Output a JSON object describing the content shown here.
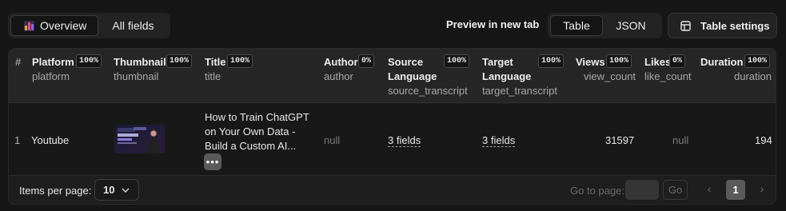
{
  "toolbar": {
    "tabs": [
      "Overview",
      "All fields"
    ],
    "preview_link": "Preview in new tab",
    "formats": [
      "Table",
      "JSON"
    ],
    "settings_label": "Table settings"
  },
  "table": {
    "columns": [
      {
        "label": "#",
        "key": "",
        "pct": ""
      },
      {
        "label": "Platform",
        "key": "platform",
        "pct": "100%"
      },
      {
        "label": "Thumbnail",
        "key": "thumbnail",
        "pct": "100%"
      },
      {
        "label": "Title",
        "key": "title",
        "pct": "100%"
      },
      {
        "label": "Author",
        "key": "author",
        "pct": "0%"
      },
      {
        "label": "Source Language",
        "label_line1": "Source",
        "label_line2": "Language",
        "key": "source_transcript",
        "pct": "100%"
      },
      {
        "label": "Target Language",
        "label_line1": "Target",
        "label_line2": "Language",
        "key": "target_transcript",
        "pct": "100%"
      },
      {
        "label": "Views",
        "key": "view_count",
        "pct": "100%"
      },
      {
        "label": "Likes",
        "key": "like_count",
        "pct": "0%"
      },
      {
        "label": "Duration",
        "key": "duration",
        "pct": "100%"
      }
    ],
    "rows": [
      {
        "index": "1",
        "platform": "Youtube",
        "thumbnail_icon": "video-thumbnail-image",
        "title_lines": [
          "How to Train ChatGPT",
          "on Your Own Data -",
          "Build a Custom AI..."
        ],
        "author": "null",
        "source_transcript": "3 fields",
        "target_transcript": "3 fields",
        "views": "31597",
        "likes": "null",
        "duration": "194"
      }
    ]
  },
  "pagination": {
    "items_per_page_label": "Items per page:",
    "items_per_page": "10",
    "goto_label": "Go to page:",
    "go_label": "Go",
    "current_page": "1"
  }
}
